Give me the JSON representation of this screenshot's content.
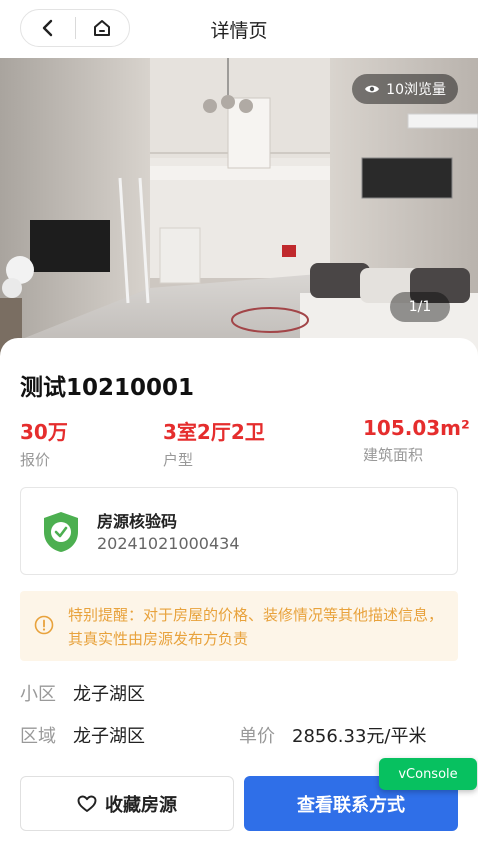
{
  "header": {
    "title": "详情页",
    "back_icon": "chevron-left-icon",
    "home_icon": "home-icon"
  },
  "gallery": {
    "views_label": "10浏览量",
    "page_indicator": "1/1"
  },
  "listing": {
    "title": "测试10210001",
    "price": {
      "value": "30万",
      "label": "报价"
    },
    "layout": {
      "value": "3室2厅2卫",
      "label": "户型"
    },
    "area": {
      "value": "105.03m²",
      "label": "建筑面积"
    }
  },
  "verification": {
    "title": "房源核验码",
    "code": "20241021000434"
  },
  "notice": {
    "text": "特别提醒：对于房屋的价格、装修情况等其他描述信息，其真实性由房源发布方负责"
  },
  "info": {
    "community_label": "小区",
    "community_value": "龙子湖区",
    "district_label": "区域",
    "district_value": "龙子湖区",
    "unit_price_label": "单价",
    "unit_price_value": "2856.33元/平米"
  },
  "actions": {
    "favorite_label": "收藏房源",
    "contact_label": "查看联系方式"
  },
  "vconsole": {
    "label": "vConsole"
  },
  "colors": {
    "accent_red": "#e52d2d",
    "primary_blue": "#2f6fe8",
    "vconsole_green": "#07c160",
    "notice_orange": "#e8a23c",
    "shield_green": "#4caf50"
  }
}
